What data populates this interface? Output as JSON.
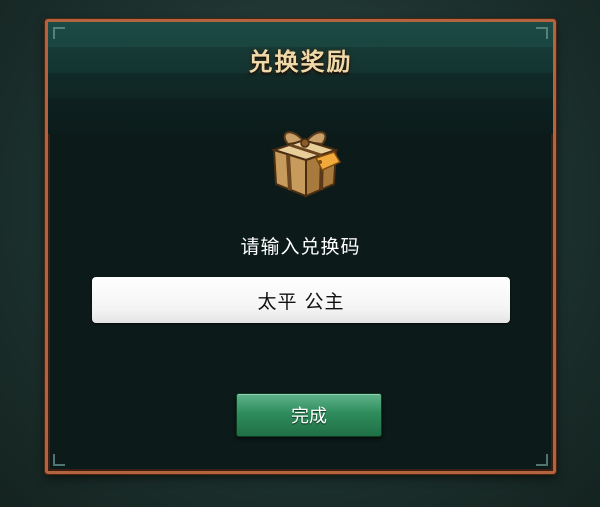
{
  "dialog": {
    "title": "兑换奖励",
    "icon": "gift-box-icon",
    "prompt": "请输入兑换码",
    "code_input": {
      "value": "太平 公主",
      "placeholder": ""
    },
    "confirm_label": "完成"
  },
  "colors": {
    "frame_border": "#b4643c",
    "title_text": "#f0d9a8",
    "button_green": "#2f8d5d",
    "panel_background": "#0c1a19"
  }
}
